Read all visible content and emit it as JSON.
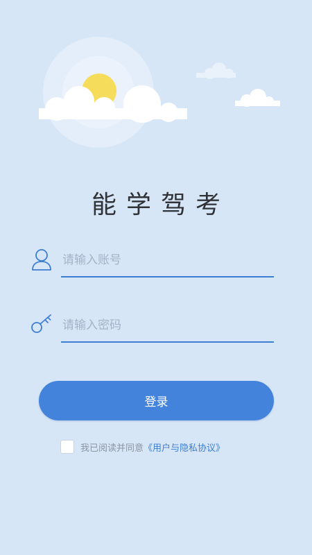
{
  "app": {
    "title": "能学驾考"
  },
  "login_form": {
    "account": {
      "placeholder": "请输入账号",
      "value": ""
    },
    "password": {
      "placeholder": "请输入密码",
      "value": ""
    },
    "submit_label": "登录"
  },
  "agreement": {
    "checked": false,
    "prefix": "我已阅读并同意",
    "link_text": "《用户与隐私协议》"
  },
  "icons": {
    "account": "user-icon",
    "password": "key-icon"
  },
  "colors": {
    "background": "#d7e6f6",
    "accent": "#4383dc",
    "sun": "#f5dc5a",
    "title": "#2f3338"
  }
}
